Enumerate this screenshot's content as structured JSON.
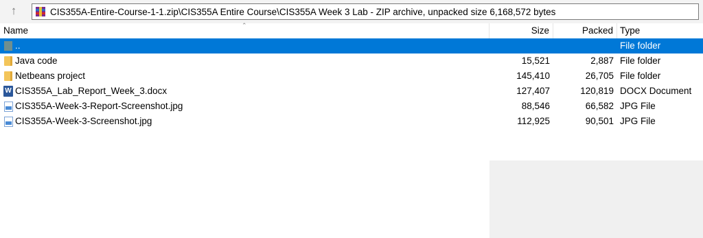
{
  "address": {
    "path": "CIS355A-Entire-Course-1-1.zip\\CIS355A Entire Course\\CIS355A Week 3 Lab - ZIP archive, unpacked size 6,168,572 bytes"
  },
  "columns": {
    "name": "Name",
    "size": "Size",
    "packed": "Packed",
    "type": "Type"
  },
  "rows": [
    {
      "name": "..",
      "size": "",
      "packed": "",
      "type": "File folder",
      "icon": "parent-folder-icon",
      "selected": true
    },
    {
      "name": "Java code",
      "size": "15,521",
      "packed": "2,887",
      "type": "File folder",
      "icon": "folder-icon"
    },
    {
      "name": "Netbeans project",
      "size": "145,410",
      "packed": "26,705",
      "type": "File folder",
      "icon": "folder-icon"
    },
    {
      "name": "CIS355A_Lab_Report_Week_3.docx",
      "size": "127,407",
      "packed": "120,819",
      "type": "DOCX Document",
      "icon": "word-document-icon"
    },
    {
      "name": "CIS355A-Week-3-Report-Screenshot.jpg",
      "size": "88,546",
      "packed": "66,582",
      "type": "JPG File",
      "icon": "jpg-image-icon"
    },
    {
      "name": "CIS355A-Week-3-Screenshot.jpg",
      "size": "112,925",
      "packed": "90,501",
      "type": "JPG File",
      "icon": "jpg-image-icon"
    }
  ],
  "colors": {
    "selection": "#0078d7",
    "folder": "#f3c55a",
    "word": "#2b579a"
  }
}
